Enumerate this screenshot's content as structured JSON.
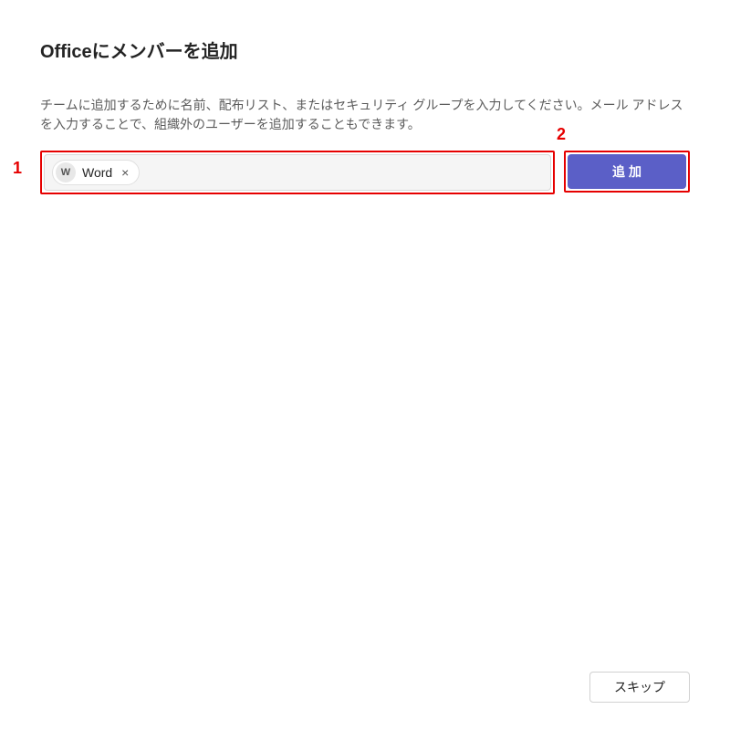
{
  "dialog": {
    "title": "Officeにメンバーを追加",
    "description": "チームに追加するために名前、配布リスト、またはセキュリティ グループを入力してください。メール アドレスを入力することで、組織外のユーザーを追加することもできます。",
    "member_chip": {
      "avatar_initial": "W",
      "label": "Word"
    },
    "add_button_label": "追加",
    "skip_button_label": "スキップ"
  },
  "annotations": {
    "step1": "1",
    "step2": "2"
  }
}
